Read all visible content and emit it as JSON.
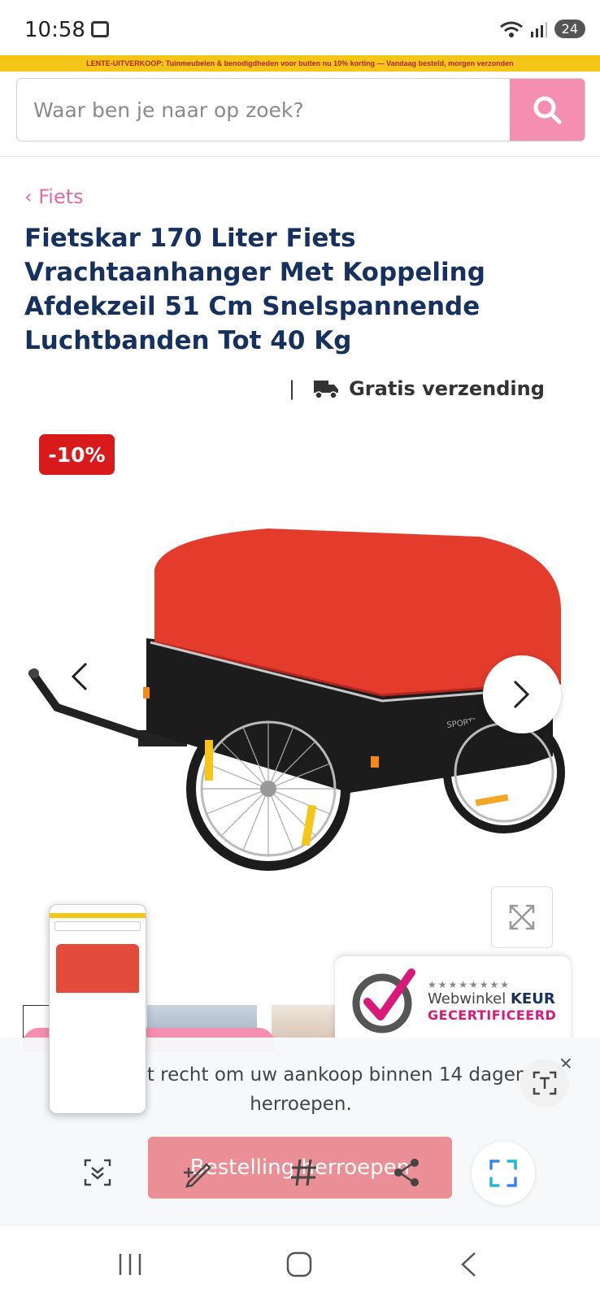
{
  "status": {
    "time": "10:58",
    "battery": "24",
    "icons": [
      "screen-cast-icon",
      "wifi-icon",
      "signal-icon",
      "battery-icon"
    ]
  },
  "promo": {
    "text": "LENTE-UITVERKOOP: Tuinmeubelen & benodigdheden voor buiten nu 10% korting — Vandaag besteld, morgen verzonden"
  },
  "search": {
    "placeholder": "Waar ben je naar op zoek?"
  },
  "breadcrumb": {
    "label": "Fiets"
  },
  "product": {
    "title": "Fietskar 170 Liter Fiets Vrachtaanhanger Met Koppeling Afdekzeil 51 Cm Snelspannende Luchtbanden Tot 40 Kg",
    "shipping": "Gratis verzending",
    "discount": "-10%",
    "brand_on_image": "SPORTNOW"
  },
  "badge": {
    "line1_prefix": "Webwinkel",
    "line1_bold": "KEUR",
    "line2": "GECERTIFICEERD",
    "stars": "★★★★★★★★"
  },
  "withdraw": {
    "text": "U heeft het recht om uw aankoop binnen 14 dagen te herroepen.",
    "button": "Bestelling herroepen"
  },
  "colors": {
    "accent_pink": "#f48fb1",
    "title_navy": "#17315e",
    "discount_red": "#d91a1a",
    "promo_yellow": "#f5c518"
  }
}
